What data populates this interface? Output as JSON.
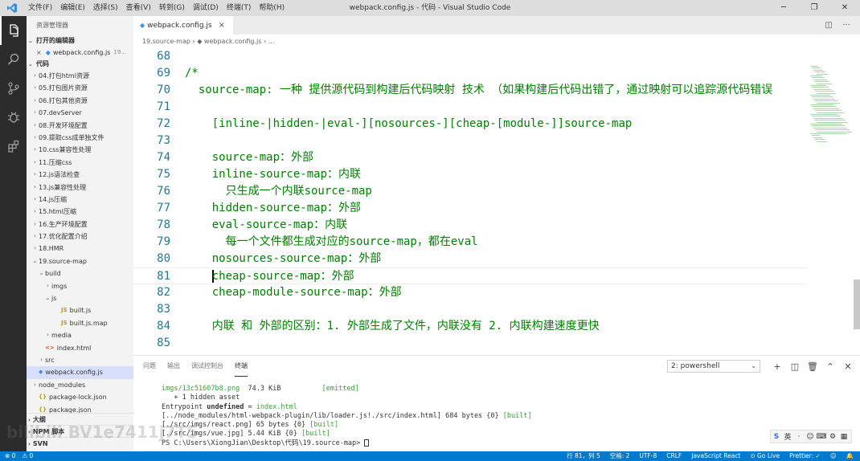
{
  "window": {
    "title": "webpack.config.js - 代码 - Visual Studio Code",
    "menu": [
      "文件(F)",
      "编辑(E)",
      "选择(S)",
      "查看(V)",
      "转到(G)",
      "调试(D)",
      "终端(T)",
      "帮助(H)"
    ]
  },
  "activity_bar": {
    "icons": [
      "files-icon",
      "search-icon",
      "source-control-icon",
      "debug-icon",
      "extensions-icon"
    ]
  },
  "sidebar": {
    "title": "资源管理器",
    "open_editors_header": "打开的编辑器",
    "open_editor": {
      "badge": "×",
      "name": "webpack.config.js",
      "suffix": "19..."
    },
    "folder_header": "代码",
    "tree": [
      {
        "label": "04.打包html资源",
        "chev": "›"
      },
      {
        "label": "05.打包图片资源",
        "chev": "›"
      },
      {
        "label": "06.打包其他资源",
        "chev": "›"
      },
      {
        "label": "07.devServer",
        "chev": "›"
      },
      {
        "label": "08.开发环境配置",
        "chev": "›"
      },
      {
        "label": "09.提取css成单独文件",
        "chev": "›"
      },
      {
        "label": "10.css兼容性处理",
        "chev": "›"
      },
      {
        "label": "11.压缩css",
        "chev": "›"
      },
      {
        "label": "12.js语法检查",
        "chev": "›"
      },
      {
        "label": "13.js兼容性处理",
        "chev": "›"
      },
      {
        "label": "14.js压缩",
        "chev": "›"
      },
      {
        "label": "15.html压缩",
        "chev": "›"
      },
      {
        "label": "16.生产环境配置",
        "chev": "›"
      },
      {
        "label": "17.优化配置介绍",
        "chev": "›"
      },
      {
        "label": "18.HMR",
        "chev": "›"
      },
      {
        "label": "19.source-map",
        "chev": "⌄"
      },
      {
        "label": "build",
        "chev": "⌄"
      },
      {
        "label": "imgs",
        "chev": "›"
      },
      {
        "label": "js",
        "chev": "⌄"
      },
      {
        "label": "built.js",
        "chev": "",
        "icon": "JS"
      },
      {
        "label": "built.js.map",
        "chev": "",
        "icon": "JS"
      },
      {
        "label": "media",
        "chev": "›"
      },
      {
        "label": "index.html",
        "chev": "",
        "icon": "<>"
      },
      {
        "label": "src",
        "chev": "›"
      },
      {
        "label": "webpack.config.js",
        "chev": "",
        "icon": "◆",
        "selected": true
      },
      {
        "label": "node_modules",
        "chev": "›"
      },
      {
        "label": "package-lock.json",
        "chev": "",
        "icon": "{}"
      },
      {
        "label": "package.json",
        "chev": "",
        "icon": "{}"
      }
    ],
    "bottom_sections": [
      "大纲",
      "NPM 脚本",
      "SVN"
    ]
  },
  "editor": {
    "tab_label": "webpack.config.js",
    "tab_close": "×",
    "breadcrumb": "19.source-map  ›  ◆ webpack.config.js  ›  ...",
    "lines": [
      {
        "num": "68",
        "text": ""
      },
      {
        "num": "69",
        "text": "/*"
      },
      {
        "num": "70",
        "text": "  source-map: 一种 提供源代码到构建后代码映射 技术 （如果构建后代码出错了，通过映射可以追踪源代码错误"
      },
      {
        "num": "71",
        "text": ""
      },
      {
        "num": "72",
        "text": "    [inline-|hidden-|eval-][nosources-][cheap-[module-]]source-map"
      },
      {
        "num": "73",
        "text": ""
      },
      {
        "num": "74",
        "text": "    source-map：外部"
      },
      {
        "num": "75",
        "text": "    inline-source-map：内联"
      },
      {
        "num": "76",
        "text": "      只生成一个内联source-map"
      },
      {
        "num": "77",
        "text": "    hidden-source-map：外部"
      },
      {
        "num": "78",
        "text": "    eval-source-map：内联"
      },
      {
        "num": "79",
        "text": "      每一个文件都生成对应的source-map，都在eval"
      },
      {
        "num": "80",
        "text": "    nosources-source-map：外部"
      },
      {
        "num": "81",
        "text": "cheap-source-map：外部",
        "cursor": true
      },
      {
        "num": "82",
        "text": "    cheap-module-source-map：外部"
      },
      {
        "num": "83",
        "text": ""
      },
      {
        "num": "84",
        "text": "    内联 和 外部的区别：1. 外部生成了文件，内联没有 2. 内联构建速度更快"
      },
      {
        "num": "85",
        "text": ""
      }
    ],
    "cursor_indent": "    "
  },
  "panel": {
    "tabs": [
      "问题",
      "输出",
      "调试控制台",
      "终端"
    ],
    "active_tab": "终端",
    "terminal_select": "2: powershell",
    "terminal": {
      "line1_file": "imgs/13c51607b8.png",
      "line1_size": "74.3 KiB",
      "line1_status": "[emitted]",
      "line2": "   + 1 hidden asset",
      "line3_prefix": "Entrypoint ",
      "line3_bold": "undefined",
      "line3_eq": " = ",
      "line3_file": "index.html",
      "line4_path": "[../node_modules/html-webpack-plugin/lib/loader.js!./src/index.html]",
      "line4_rest": " 684 bytes {0} ",
      "line4_status": "[built]",
      "line5_path": "[./src/imgs/react.png]",
      "line5_rest": " 65 bytes {0} ",
      "line5_status": "[built]",
      "line6_path": "[./src/imgs/vue.jpg]",
      "line6_rest": " 5.44 KiB {0} ",
      "line6_status": "[built]",
      "prompt": "PS C:\\Users\\XiongJian\\Desktop\\代码\\19.source-map> "
    }
  },
  "tray": {
    "items": [
      "S",
      "英",
      "·",
      "☺",
      "⌨",
      "⚙",
      "▦"
    ]
  },
  "watermark": "bilibili BV1e7411j7T5",
  "statusbar": {
    "left": [
      "⊗ 0",
      "⚠ 0"
    ],
    "right": [
      "行 81，列 5",
      "空格: 2",
      "UTF-8",
      "CRLF",
      "JavaScript React",
      "⊙ Go Live",
      "Prettier: ✓",
      "☺",
      "🔔"
    ]
  },
  "colors": {
    "statusbar": "#007acc",
    "comment": "#008000",
    "line_number": "#237893",
    "activity_bar": "#2c2c2c",
    "sidebar": "#f3f3f3"
  }
}
